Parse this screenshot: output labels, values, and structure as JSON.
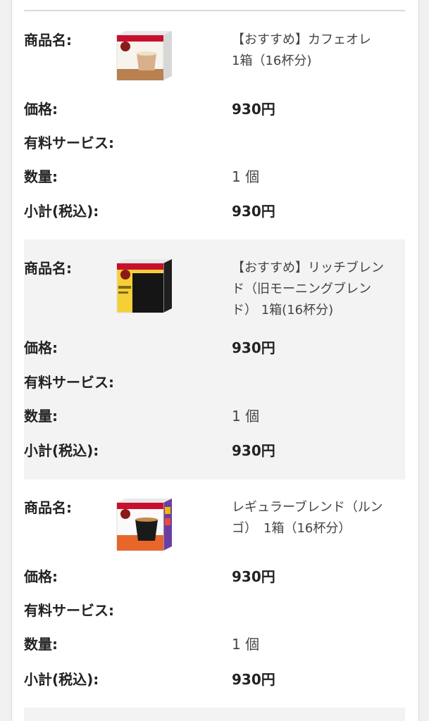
{
  "labels": {
    "name": "商品名:",
    "price": "価格:",
    "service": "有料サービス:",
    "quantity": "数量:",
    "subtotal": "小計(税込):"
  },
  "items": [
    {
      "name": "【おすすめ】カフェオレ　1箱（16杯分)",
      "price": "930円",
      "service": "",
      "quantity": "1 個",
      "subtotal": "930円",
      "image": "cafe-au-lait-capsule-box",
      "accent": "#c9956a"
    },
    {
      "name": "【おすすめ】リッチブレンド（旧モーニングブレンド） 1箱(16杯分)",
      "price": "930円",
      "service": "",
      "quantity": "1 個",
      "subtotal": "930円",
      "image": "rich-blend-capsule-box",
      "accent": "#f2d33a"
    },
    {
      "name": "レギュラーブレンド（ルンゴ）　1箱（16杯分）",
      "price": "930円",
      "service": "",
      "quantity": "1 個",
      "subtotal": "930円",
      "image": "regular-blend-lungo-capsule-box",
      "accent": "#e8662a"
    }
  ]
}
